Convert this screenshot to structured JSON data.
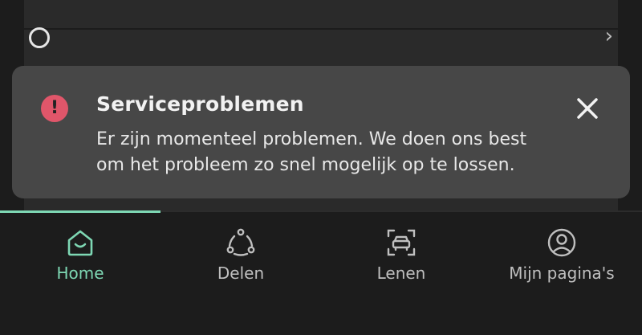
{
  "toast": {
    "icon": "alert-icon",
    "icon_glyph": "!",
    "title": "Serviceproblemen",
    "message": "Er zijn momenteel problemen. We doen ons best om het probleem zo snel mogelijk op te lossen.",
    "close_icon": "close-icon"
  },
  "tabs": [
    {
      "label": "Home",
      "icon": "home-icon",
      "active": true
    },
    {
      "label": "Delen",
      "icon": "share-icon",
      "active": false
    },
    {
      "label": "Lenen",
      "icon": "car-icon",
      "active": false
    },
    {
      "label": "Mijn pagina's",
      "icon": "user-icon",
      "active": false
    }
  ],
  "colors": {
    "accent": "#7ed8b4",
    "alert": "#e0566a",
    "toast_bg": "#474747",
    "background": "#1c1c1c"
  }
}
